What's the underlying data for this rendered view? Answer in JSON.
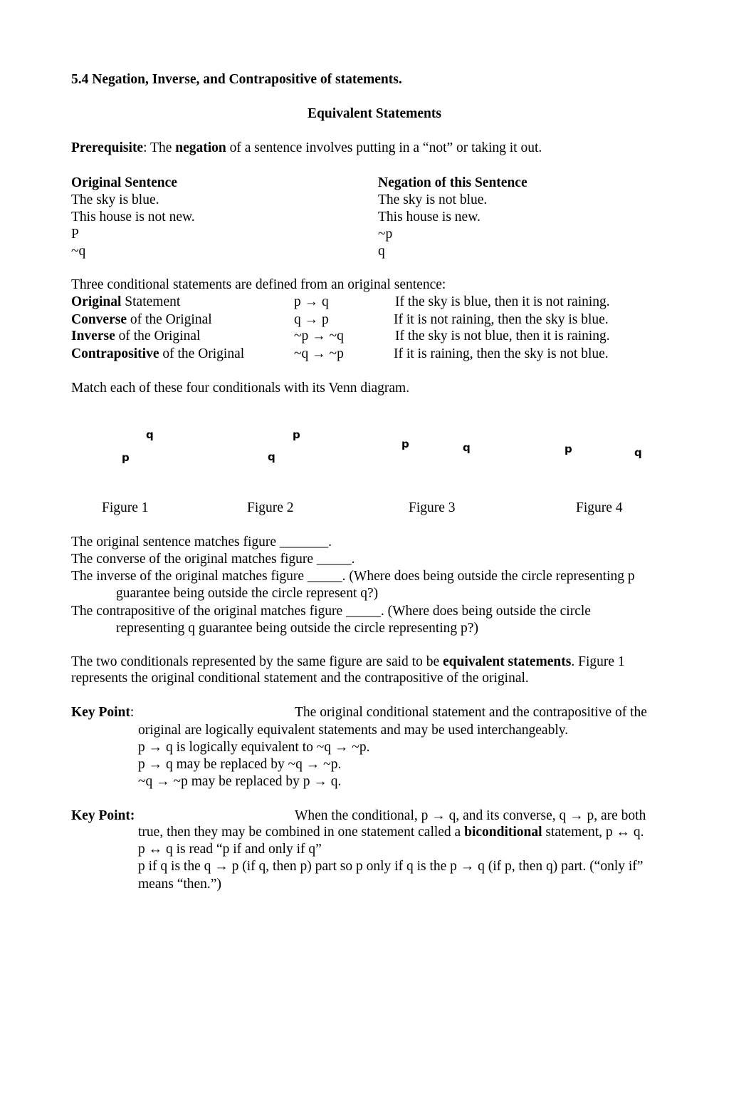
{
  "heading": "5.4 Negation, Inverse, and Contrapositive of statements.",
  "subtitle": "Equivalent Statements",
  "prerequisite": {
    "label": "Prerequisite",
    "pre": ":  The ",
    "bold": "negation",
    "post": " of a sentence involves putting in a “not” or taking it out."
  },
  "negation_table": {
    "headers": [
      "Original Sentence",
      "Negation of this Sentence"
    ],
    "rows": [
      [
        "The sky is blue.",
        "The sky is not blue."
      ],
      [
        "This house is not new.",
        "This house is new."
      ],
      [
        "P",
        "~p"
      ],
      [
        "~q",
        "q"
      ]
    ]
  },
  "conditionals": {
    "intro": "Three conditional statements are defined from an original sentence:",
    "rows": [
      {
        "bold": "Original",
        "rest": " Statement",
        "symbol": "p → q",
        "example": "If the sky is blue, then it is not raining."
      },
      {
        "bold": "Converse",
        "rest": " of the Original",
        "symbol": "q → p",
        "example": "If it is not raining, then the sky is blue."
      },
      {
        "bold": "Inverse",
        "rest": " of the Original",
        "symbol": "~p → ~q",
        "example": "If the sky is not blue, then it is raining."
      },
      {
        "bold": "Contrapositive",
        "rest": " of the Original",
        "symbol": "~q → ~p",
        "example": "If it is raining, then the sky is not blue."
      }
    ]
  },
  "match_instruction": "Match each of these four conditionals with its Venn diagram.",
  "figures": [
    {
      "caption": "Figure 1",
      "labels": [
        "q",
        "p"
      ]
    },
    {
      "caption": "Figure 2",
      "labels": [
        "p",
        "q"
      ]
    },
    {
      "caption": "Figure 3",
      "labels": [
        "p",
        "q"
      ]
    },
    {
      "caption": "Figure 4",
      "labels": [
        "p",
        "q"
      ]
    }
  ],
  "questions": [
    "The original sentence matches figure _______.",
    "The converse of the original matches figure _____.",
    "The inverse of the original matches figure _____.  (Where does being outside the circle representing p",
    "guarantee being outside the circle represent q?)",
    "The contrapositive of the original matches figure _____.  (Where does being outside the circle",
    "representing q guarantee being outside the circle representing p?)"
  ],
  "equivalent": {
    "pre": "The two conditionals represented by the same figure are said to be ",
    "bold": "equivalent statements",
    "post": ".  Figure 1",
    "line2": "represents the original conditional statement and the contrapositive of the original."
  },
  "keypoint1": {
    "label": "Key Point",
    "colon": ":",
    "first": "The original conditional statement and the contrapositive of the",
    "lines": [
      "original are logically equivalent statements and may be used interchangeably.",
      "p → q is logically equivalent to ~q → ~p.",
      "p → q may be replaced by ~q → ~p.",
      "~q → ~p may be replaced by p → q."
    ]
  },
  "keypoint2": {
    "label": "Key Point:",
    "first": "When the conditional, p → q, and its converse, q → p, are both",
    "line2_pre": "true, then they may be combined in one statement called a ",
    "line2_bold": "biconditional",
    "line2_post": " statement, p ↔ q.",
    "lines": [
      "p ↔ q is read “p if and only if q”",
      "p if q is the q → p (if q, then p) part so p only if q is the p → q (if p, then q) part.  (“only if”",
      "means “then.”)"
    ]
  }
}
